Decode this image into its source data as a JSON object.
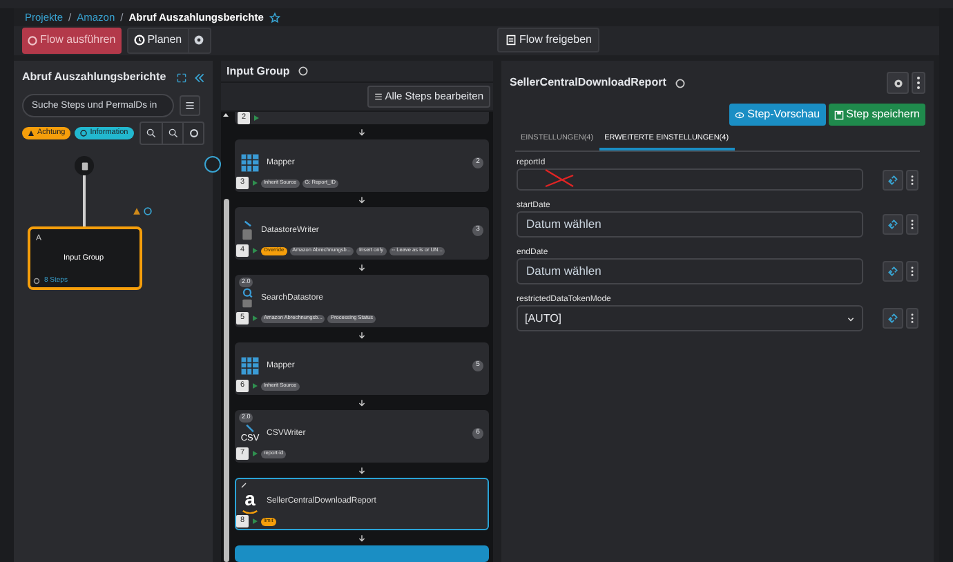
{
  "breadcrumb_separators": [
    "/",
    "/"
  ],
  "breadcrumb": [
    {
      "label": "Projekte",
      "link": true
    },
    {
      "label": "Amazon",
      "link": true
    },
    {
      "label": "Abruf Auszahlungsberichte",
      "link": false
    }
  ],
  "toolbar": {
    "run": "Flow ausführen",
    "schedule": "Planen",
    "publish": "Flow freigeben"
  },
  "left_panel": {
    "title": "Abruf Auszahlungsberichte",
    "search": {
      "placeholder": "Suche Steps und PermalDs in"
    },
    "legend": [
      {
        "label": "Achtung",
        "color": "#f59e0b"
      },
      {
        "label": "Information",
        "color": "#22b8cf"
      }
    ],
    "node": {
      "letter": "A",
      "title": "Input Group",
      "steps": "8 Steps",
      "selected": true
    }
  },
  "steps_panel": {
    "title": "Input Group",
    "edit_all": "Alle Steps bearbeiten",
    "first_number": "2",
    "steps": [
      {
        "number": "3",
        "kind": "grid",
        "name": "Mapper",
        "badges": [
          {
            "text": "Inherit Source",
            "kind": "plain"
          },
          {
            "text": "G: Report_ID",
            "kind": "plain"
          }
        ],
        "count": "2",
        "selected": false
      },
      {
        "number": "4",
        "kind": "writer",
        "name": "DatastoreWriter",
        "badges": [
          {
            "text": "Override",
            "kind": "warn"
          },
          {
            "text": "Amazon Abrechnungsb...",
            "kind": "plain"
          },
          {
            "text": "Insert only",
            "kind": "plain"
          },
          {
            "text": "-- Leave as is or UN...",
            "kind": "plain"
          }
        ],
        "count": "3",
        "selected": false
      },
      {
        "number": "5",
        "kind": "search",
        "version": "2.0",
        "name": "SearchDatastore",
        "badges": [
          {
            "text": "Amazon Abrechnungsb...",
            "kind": "plain"
          },
          {
            "text": "Processing Status",
            "kind": "plain"
          }
        ],
        "selected": false
      },
      {
        "number": "6",
        "kind": "grid",
        "name": "Mapper",
        "badges": [
          {
            "text": "Inherit Source",
            "kind": "plain"
          }
        ],
        "count": "5",
        "selected": false
      },
      {
        "number": "7",
        "kind": "csv",
        "icon_text": "CSV",
        "version": "2.0",
        "name": "CSVWriter",
        "badges": [
          {
            "text": "report-id",
            "kind": "plain"
          }
        ],
        "count": "6",
        "selected": false
      },
      {
        "number": "8",
        "kind": "amazon",
        "icon_text": "a",
        "name": "SellerCentralDownloadReport",
        "badges": [
          {
            "text": "limit",
            "kind": "warn"
          }
        ],
        "selected": true
      }
    ]
  },
  "detail": {
    "title": "SellerCentralDownloadReport",
    "preview": "Step-Vorschau",
    "save": "Step speichern",
    "tabs": [
      {
        "label": "EINSTELLUNGEN(4)",
        "selected": false
      },
      {
        "label": "ERWEITERTE EINSTELLUNGEN(4)",
        "selected": true
      }
    ],
    "fields": [
      {
        "label": "reportId",
        "kind": "text",
        "crossed_out": true
      },
      {
        "label": "startDate",
        "kind": "date",
        "placeholder": "Datum wählen"
      },
      {
        "label": "endDate",
        "kind": "date",
        "placeholder": "Datum wählen"
      },
      {
        "label": "restrictedDataTokenMode",
        "kind": "select",
        "value": "[AUTO]"
      }
    ]
  }
}
